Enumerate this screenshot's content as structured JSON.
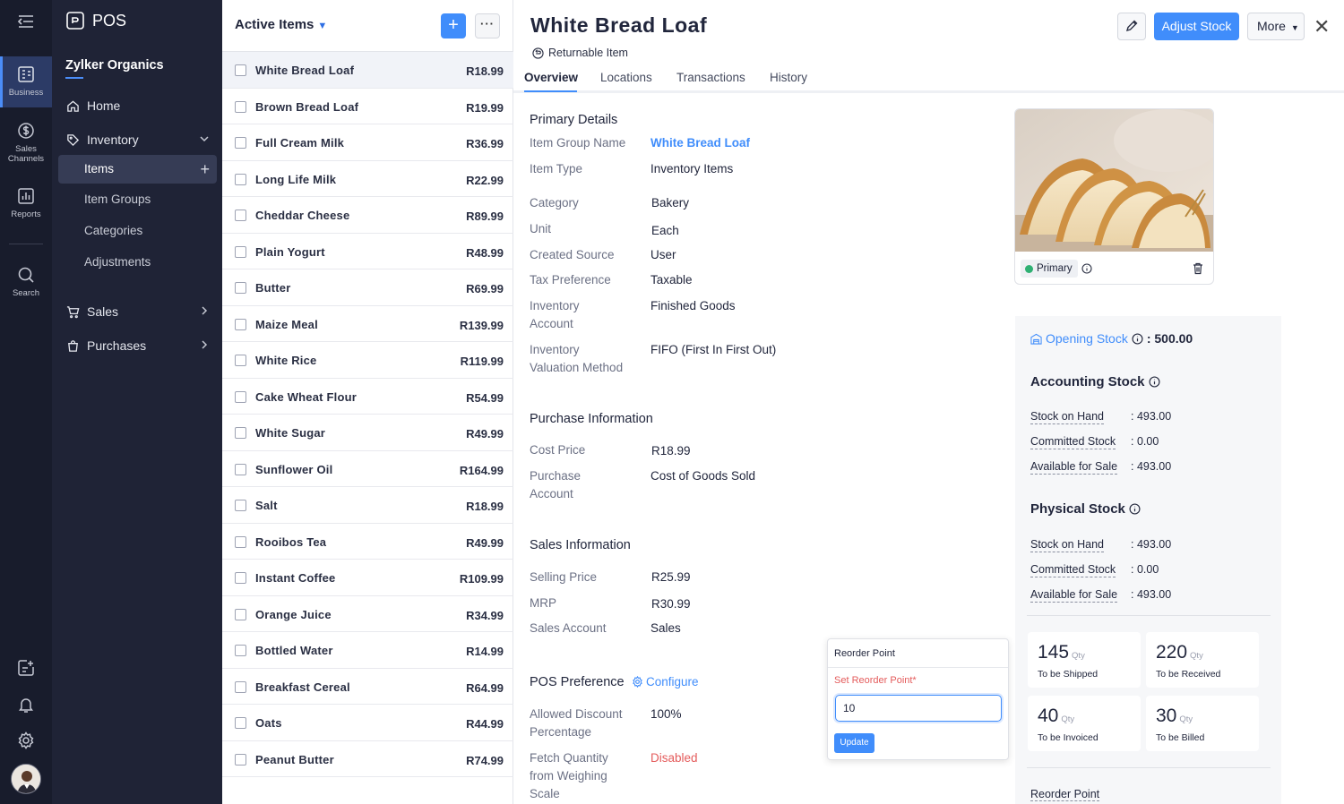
{
  "rail": {
    "items": [
      {
        "label": "Business"
      },
      {
        "label": "Sales Channels"
      },
      {
        "label": "Reports"
      },
      {
        "label": "Search"
      }
    ]
  },
  "sidebar": {
    "app_name": "POS",
    "org_name": "Zylker Organics",
    "nav": {
      "home": "Home",
      "inventory": "Inventory",
      "items": "Items",
      "item_groups": "Item Groups",
      "categories": "Categories",
      "adjustments": "Adjustments",
      "sales": "Sales",
      "purchases": "Purchases"
    }
  },
  "list": {
    "title": "Active Items",
    "items": [
      {
        "name": "White Bread Loaf",
        "price": "R18.99"
      },
      {
        "name": "Brown Bread Loaf",
        "price": "R19.99"
      },
      {
        "name": "Full Cream Milk",
        "price": "R36.99"
      },
      {
        "name": "Long Life Milk",
        "price": "R22.99"
      },
      {
        "name": "Cheddar Cheese",
        "price": "R89.99"
      },
      {
        "name": "Plain Yogurt",
        "price": "R48.99"
      },
      {
        "name": "Butter",
        "price": "R69.99"
      },
      {
        "name": "Maize Meal",
        "price": "R139.99"
      },
      {
        "name": "White Rice",
        "price": "R119.99"
      },
      {
        "name": "Cake Wheat Flour",
        "price": "R54.99"
      },
      {
        "name": "White Sugar",
        "price": "R49.99"
      },
      {
        "name": "Sunflower Oil",
        "price": "R164.99"
      },
      {
        "name": "Salt",
        "price": "R18.99"
      },
      {
        "name": "Rooibos Tea",
        "price": "R49.99"
      },
      {
        "name": "Instant Coffee",
        "price": "R109.99"
      },
      {
        "name": "Orange Juice",
        "price": "R34.99"
      },
      {
        "name": "Bottled Water",
        "price": "R14.99"
      },
      {
        "name": "Breakfast Cereal",
        "price": "R64.99"
      },
      {
        "name": "Oats",
        "price": "R44.99"
      },
      {
        "name": "Peanut Butter",
        "price": "R74.99"
      }
    ]
  },
  "detail": {
    "title": "White Bread Loaf",
    "returnable": "Returnable Item",
    "adjust_stock": "Adjust Stock",
    "more": "More",
    "tabs": [
      "Overview",
      "Locations",
      "Transactions",
      "History"
    ],
    "primary_details": {
      "heading": "Primary Details",
      "item_group_name_label": "Item Group Name",
      "item_group_name": "White Bread Loaf",
      "item_type_label": "Item Type",
      "item_type": "Inventory Items",
      "category_label": "Category",
      "category": "Bakery",
      "unit_label": "Unit",
      "unit": "Each",
      "created_source_label": "Created Source",
      "created_source": "User",
      "tax_preference_label": "Tax Preference",
      "tax_preference": "Taxable",
      "inventory_account_label_1": "Inventory",
      "inventory_account_label_2": "Account",
      "inventory_account": "Finished Goods",
      "valuation_label_1": "Inventory",
      "valuation_label_2": "Valuation Method",
      "valuation": "FIFO (First In First Out)"
    },
    "purchase_info": {
      "heading": "Purchase Information",
      "cost_price_label": "Cost Price",
      "cost_price": "R18.99",
      "purchase_account_label_1": "Purchase",
      "purchase_account_label_2": "Account",
      "purchase_account": "Cost of Goods Sold"
    },
    "sales_info": {
      "heading": "Sales Information",
      "selling_price_label": "Selling Price",
      "selling_price": "R25.99",
      "mrp_label": "MRP",
      "mrp": "R30.99",
      "sales_account_label": "Sales Account",
      "sales_account": "Sales"
    },
    "pos_pref": {
      "heading": "POS Preference",
      "configure": "Configure",
      "discount_label_1": "Allowed Discount",
      "discount_label_2": "Percentage",
      "discount": "100%",
      "fetch_label_1": "Fetch Quantity",
      "fetch_label_2": "from Weighing",
      "fetch_label_3": "Scale",
      "fetch": "Disabled"
    },
    "image": {
      "primary_badge": "Primary"
    },
    "stock": {
      "opening_label": "Opening Stock",
      "opening_value": ": 500.00",
      "accounting_title": "Accounting Stock",
      "physical_title": "Physical Stock",
      "accounting": [
        {
          "label": "Stock on Hand",
          "value": ": 493.00"
        },
        {
          "label": "Committed Stock",
          "value": ": 0.00"
        },
        {
          "label": "Available for Sale",
          "value": ": 493.00"
        }
      ],
      "physical": [
        {
          "label": "Stock on Hand",
          "value": ": 493.00"
        },
        {
          "label": "Committed Stock",
          "value": ": 0.00"
        },
        {
          "label": "Available for Sale",
          "value": ": 493.00"
        }
      ],
      "qty_unit": "Qty",
      "cards": [
        {
          "n": "145",
          "caption": "To be Shipped"
        },
        {
          "n": "220",
          "caption": "To be Received"
        },
        {
          "n": "40",
          "caption": "To be Invoiced"
        },
        {
          "n": "30",
          "caption": "To be Billed"
        }
      ],
      "reorder_point_label": "Reorder Point"
    },
    "reorder_popover": {
      "title": "Reorder Point",
      "field_label": "Set Reorder Point*",
      "value": "10",
      "update": "Update"
    }
  },
  "colors": {
    "accent": "#408dfb",
    "rail_bg": "#181c2c",
    "sidebar_bg": "#1f2336",
    "danger": "#e45b5b",
    "success": "#2fb073"
  }
}
